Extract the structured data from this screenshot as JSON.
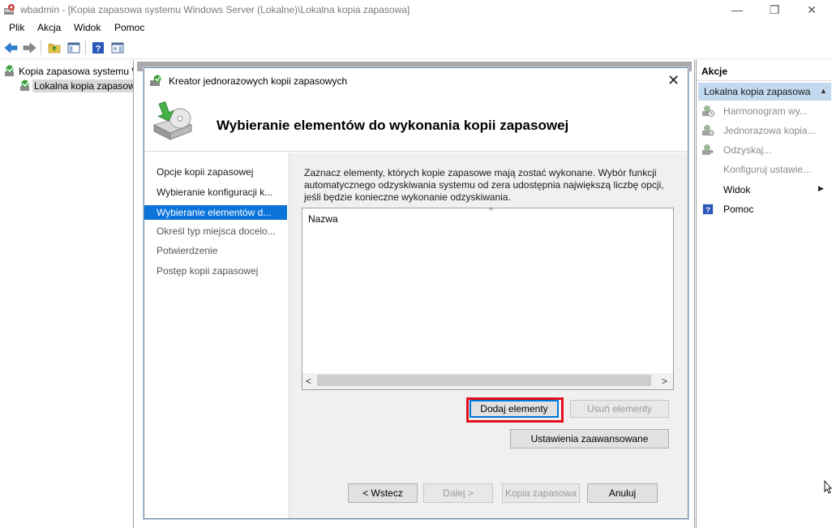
{
  "window": {
    "title": "wbadmin - [Kopia zapasowa systemu Windows Server (Lokalne)\\Lokalna kopia zapasowa]",
    "minimize_glyph": "—",
    "maximize_glyph": "❐",
    "close_glyph": "✕"
  },
  "menu": [
    "Plik",
    "Akcja",
    "Widok",
    "Pomoc"
  ],
  "toolbar": {
    "icons": [
      "back-arrow-icon",
      "forward-arrow-icon",
      "up-folder-icon",
      "show-hide-tree-icon",
      "help-icon",
      "show-hide-action-pane-icon"
    ]
  },
  "tree": {
    "items": [
      {
        "label": "Kopia zapasowa systemu W"
      },
      {
        "label": "Lokalna kopia zapasowa"
      }
    ]
  },
  "dialog": {
    "title": "Kreator jednorazowych kopii zapasowych",
    "close_glyph": "✕",
    "header": "Wybieranie elementów do wykonania kopii zapasowej",
    "steps": [
      {
        "label": "Opcje kopii zapasowej",
        "state": "done"
      },
      {
        "label": "Wybieranie konfiguracji k...",
        "state": "done"
      },
      {
        "label": "Wybieranie elementów d...",
        "state": "active"
      },
      {
        "label": "Określ typ miejsca docelo...",
        "state": "pending"
      },
      {
        "label": "Potwierdzenie",
        "state": "pending"
      },
      {
        "label": "Postęp kopii zapasowej",
        "state": "pending"
      }
    ],
    "description": "Zaznacz elementy, których kopie zapasowe mają zostać wykonane. Wybór funkcji automatycznego odzyskiwania systemu od zera udostępnia największą liczbę opcji, jeśli będzie konieczne wykonanie odzyskiwania.",
    "list": {
      "column_header": "Nazwa",
      "sort_glyph": "^",
      "scroll_left": "<",
      "scroll_right": ">"
    },
    "buttons": {
      "add_items": "Dodaj elementy",
      "remove_items": "Usuń elementy",
      "advanced_settings": "Ustawienia zaawansowane",
      "back": "< Wstecz",
      "next": "Dalej >",
      "backup": "Kopia zapasowa",
      "cancel": "Anuluj"
    }
  },
  "actions": {
    "heading": "Akcje",
    "section": "Lokalna kopia zapasowa",
    "items": [
      {
        "label": "Harmonogram wy...",
        "icon": "schedule-backup-icon",
        "enabled": false
      },
      {
        "label": "Jednorazowa kopia...",
        "icon": "backup-once-icon",
        "enabled": false
      },
      {
        "label": "Odzyskaj...",
        "icon": "recover-icon",
        "enabled": false
      },
      {
        "label": "Konfiguruj ustawie...",
        "icon": "",
        "enabled": false
      },
      {
        "label": "Widok",
        "icon": "",
        "enabled": true,
        "submenu": true
      },
      {
        "label": "Pomoc",
        "icon": "help-icon",
        "enabled": true
      }
    ]
  },
  "colors": {
    "active_step": "#0a74da",
    "highlight_frame": "#e3101c",
    "actions_section": "#c2d9f0"
  }
}
